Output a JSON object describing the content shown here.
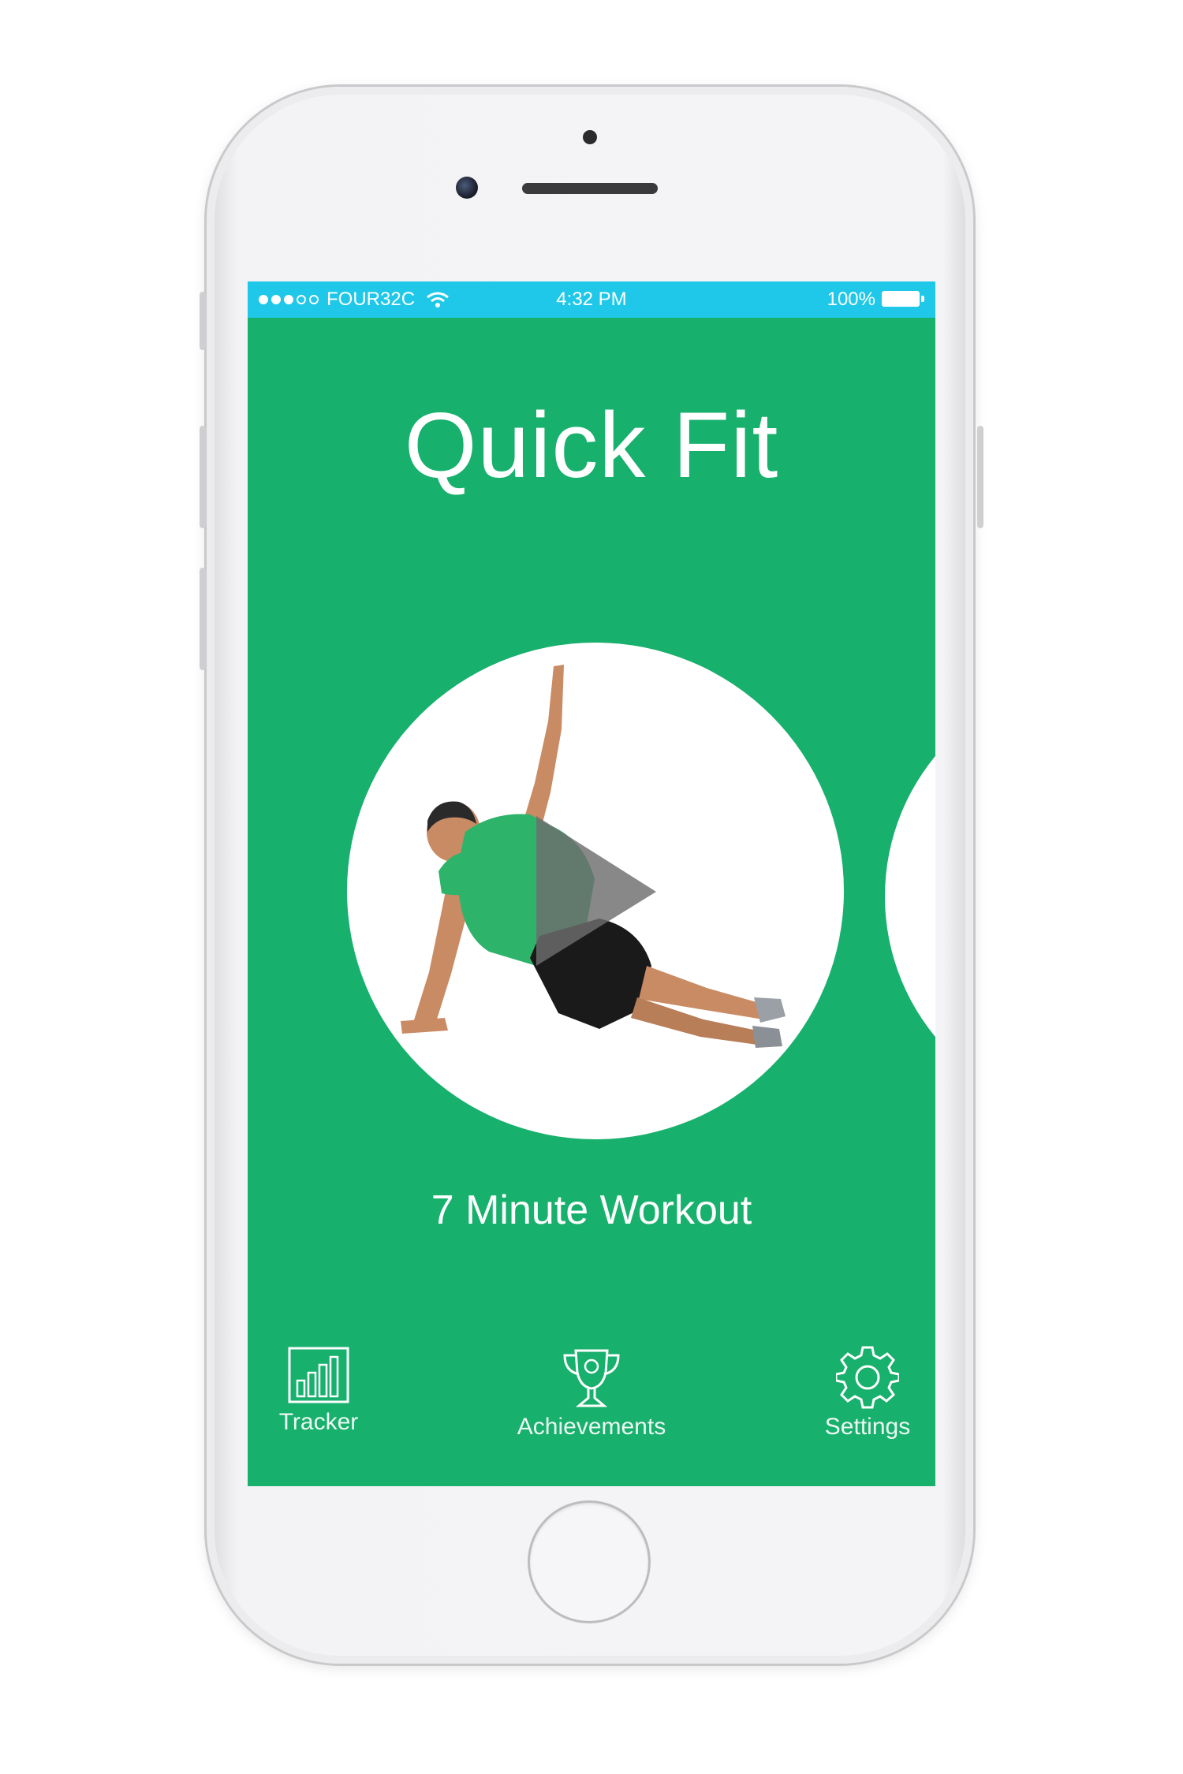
{
  "status_bar": {
    "carrier": "FOUR32C",
    "time": "4:32 PM",
    "battery": "100%"
  },
  "app": {
    "title": "Quick Fit"
  },
  "workout": {
    "label": "7 Minute Workout"
  },
  "tabs": [
    {
      "label": "Tracker",
      "icon": "bar-chart-icon"
    },
    {
      "label": "Achievements",
      "icon": "trophy-icon"
    },
    {
      "label": "Settings",
      "icon": "gear-icon"
    }
  ],
  "colors": {
    "background": "#17b06c",
    "status_bar": "#1fc8e8",
    "text": "#ffffff",
    "shirt": "#2db36a",
    "shorts": "#1a1a1a",
    "play": "#6e6e6e"
  }
}
